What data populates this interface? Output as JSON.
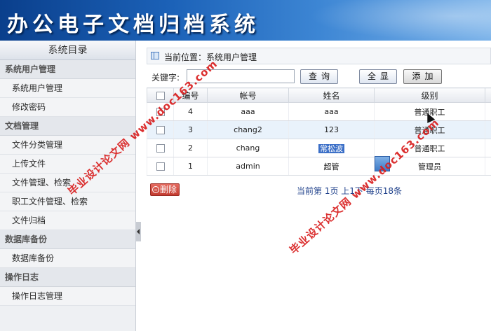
{
  "header": {
    "title": "办公电子文档归档系统"
  },
  "sidebar": {
    "title": "系统目录",
    "groups": [
      {
        "title": "系统用户管理",
        "items": [
          "系统用户管理",
          "修改密码"
        ]
      },
      {
        "title": "文档管理",
        "items": [
          "文件分类管理",
          "上传文件",
          "文件管理、检索",
          "职工文件管理、检索",
          "文件归档"
        ]
      },
      {
        "title": "数据库备份",
        "items": [
          "数据库备份"
        ]
      },
      {
        "title": "操作日志",
        "items": [
          "操作日志管理"
        ]
      }
    ]
  },
  "breadcrumb": {
    "text": "当前位置：系统用户管理"
  },
  "search": {
    "label": "关键字:",
    "value": "",
    "query_button": "查询",
    "show_all_button": "全显",
    "add_button": "添加"
  },
  "table": {
    "headers": [
      "编号",
      "帐号",
      "姓名",
      "级别"
    ],
    "rows": [
      {
        "id": "4",
        "account": "aaa",
        "name": "aaa",
        "level": "普通职工"
      },
      {
        "id": "3",
        "account": "chang2",
        "name": "123",
        "level": "普通职工"
      },
      {
        "id": "2",
        "account": "chang",
        "name": "常松波",
        "level": "普通职工"
      },
      {
        "id": "1",
        "account": "admin",
        "name": "超管",
        "level": "管理员"
      }
    ]
  },
  "footer": {
    "delete_button": "删除",
    "pager_text": "当前第 1页  上1下  每页18条"
  },
  "watermarks": [
    "毕业设计论文网 www.doc163.com",
    "毕业设计论文网 www.doc163.com"
  ],
  "colors": {
    "banner": "#1c62b8",
    "selection": "#3b6fc7",
    "delete": "#c23b30",
    "watermark": "#d81e1e"
  }
}
